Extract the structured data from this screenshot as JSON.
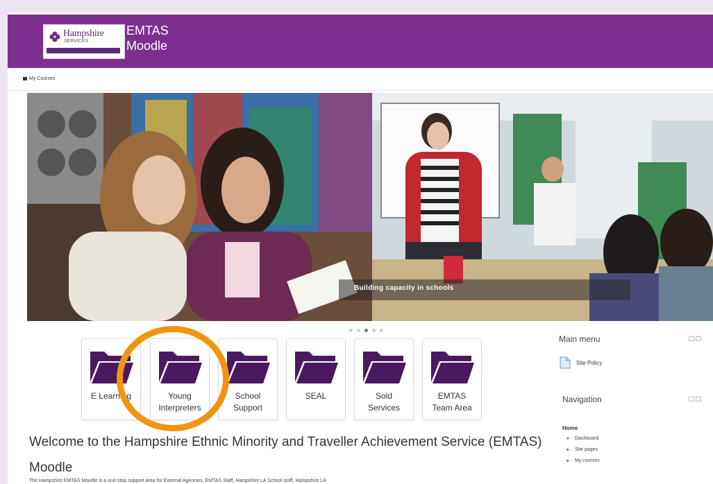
{
  "header": {
    "logo_name": "Hampshire",
    "logo_sub": "SERVICES",
    "site_title_line1": "EMTAS",
    "site_title_line2": "Moodle"
  },
  "nav": {
    "my_courses": "My Courses"
  },
  "slider": {
    "caption": "Building capacity in schools",
    "slide_count": 5,
    "active_slide": 3
  },
  "categories": [
    {
      "label": "E Learning"
    },
    {
      "label": "Young\nInterpreters"
    },
    {
      "label": "School\nSupport"
    },
    {
      "label": "SEAL"
    },
    {
      "label": "Sold\nServices"
    },
    {
      "label": "EMTAS\nTeam Area"
    }
  ],
  "welcome": {
    "heading": "Welcome to the Hampshire Ethnic Minority and Traveller Achievement Service (EMTAS) Moodle",
    "intro": "The Hampshire EMTAS Moodle is a one-stop support area for External Agencies, EMTAS Staff, Hampshire LA School staff, Hampshire LA"
  },
  "main_menu": {
    "title": "Main menu",
    "items": [
      {
        "label": "Site Policy"
      }
    ]
  },
  "navigation": {
    "title": "Navigation",
    "home": "Home",
    "items": [
      {
        "label": "Dashboard",
        "bullet": "■"
      },
      {
        "label": "Site pages",
        "bullet": "▶"
      },
      {
        "label": "My courses",
        "bullet": "▶"
      }
    ]
  },
  "colors": {
    "brand_purple": "#7d2f8f",
    "folder_purple": "#4b1960",
    "highlight_orange": "#f19510"
  }
}
